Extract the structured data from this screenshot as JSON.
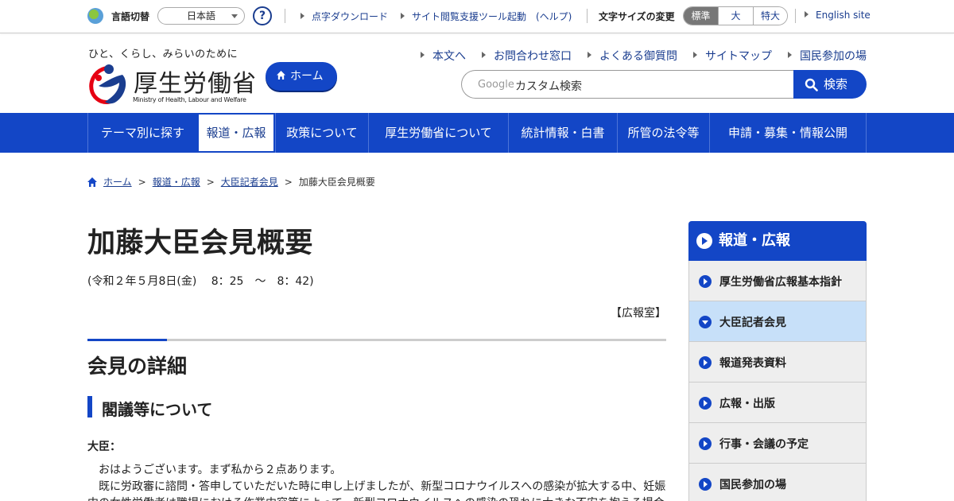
{
  "util_bar": {
    "lang_label": "言語切替",
    "lang_select": "日本語",
    "help": "?",
    "links": [
      "点字ダウンロード",
      "サイト閲覧支援ツール起動　(ヘルプ)"
    ],
    "font_size_label": "文字サイズの変更",
    "font_sizes": [
      "標準",
      "大",
      "特大"
    ],
    "english": "English site"
  },
  "header": {
    "tagline": "ひと、くらし、みらいのために",
    "logo_title": "厚生労働省",
    "logo_sub": "Ministry of Health, Labour and Welfare",
    "home": "ホーム",
    "links": [
      "本文へ",
      "お問合わせ窓口",
      "よくある御質問",
      "サイトマップ",
      "国民参加の場"
    ],
    "search_brand": "Google",
    "search_placeholder": "カスタム検索",
    "search_button": "検索"
  },
  "nav": [
    "テーマ別に探す",
    "報道・広報",
    "政策について",
    "厚生労働省について",
    "統計情報・白書",
    "所管の法令等",
    "申請・募集・情報公開"
  ],
  "breadcrumb": [
    "ホーム",
    "報道・広報",
    "大臣記者会見",
    "加藤大臣会見概要"
  ],
  "main": {
    "title": "加藤大臣会見概要",
    "date": "(令和２年５月8日(金)　 8：25　～　8：42)",
    "office": "【広報室】",
    "h2": "会見の詳細",
    "h3": "閣議等について",
    "speaker": "大臣：",
    "paragraphs": [
      "　おはようございます。まず私から２点あります。",
      "　既に労政審に諮問・答申していただいた時に申し上げましたが、新型コロナウイルスへの感染が拡大する中、妊娠",
      "中の女性労働者は職場における作業内容等によって、新型コロナウイルスへの感染の恐れに大きな不安を抱える場合"
    ]
  },
  "side": {
    "head": "報道・広報",
    "items": [
      "厚生労働省広報基本指針",
      "大臣記者会見",
      "報道発表資料",
      "広報・出版",
      "行事・会議の予定",
      "国民参加の場"
    ]
  },
  "colors": {
    "brand_blue": "#1346c6",
    "current_item": "#c7e0f9"
  }
}
